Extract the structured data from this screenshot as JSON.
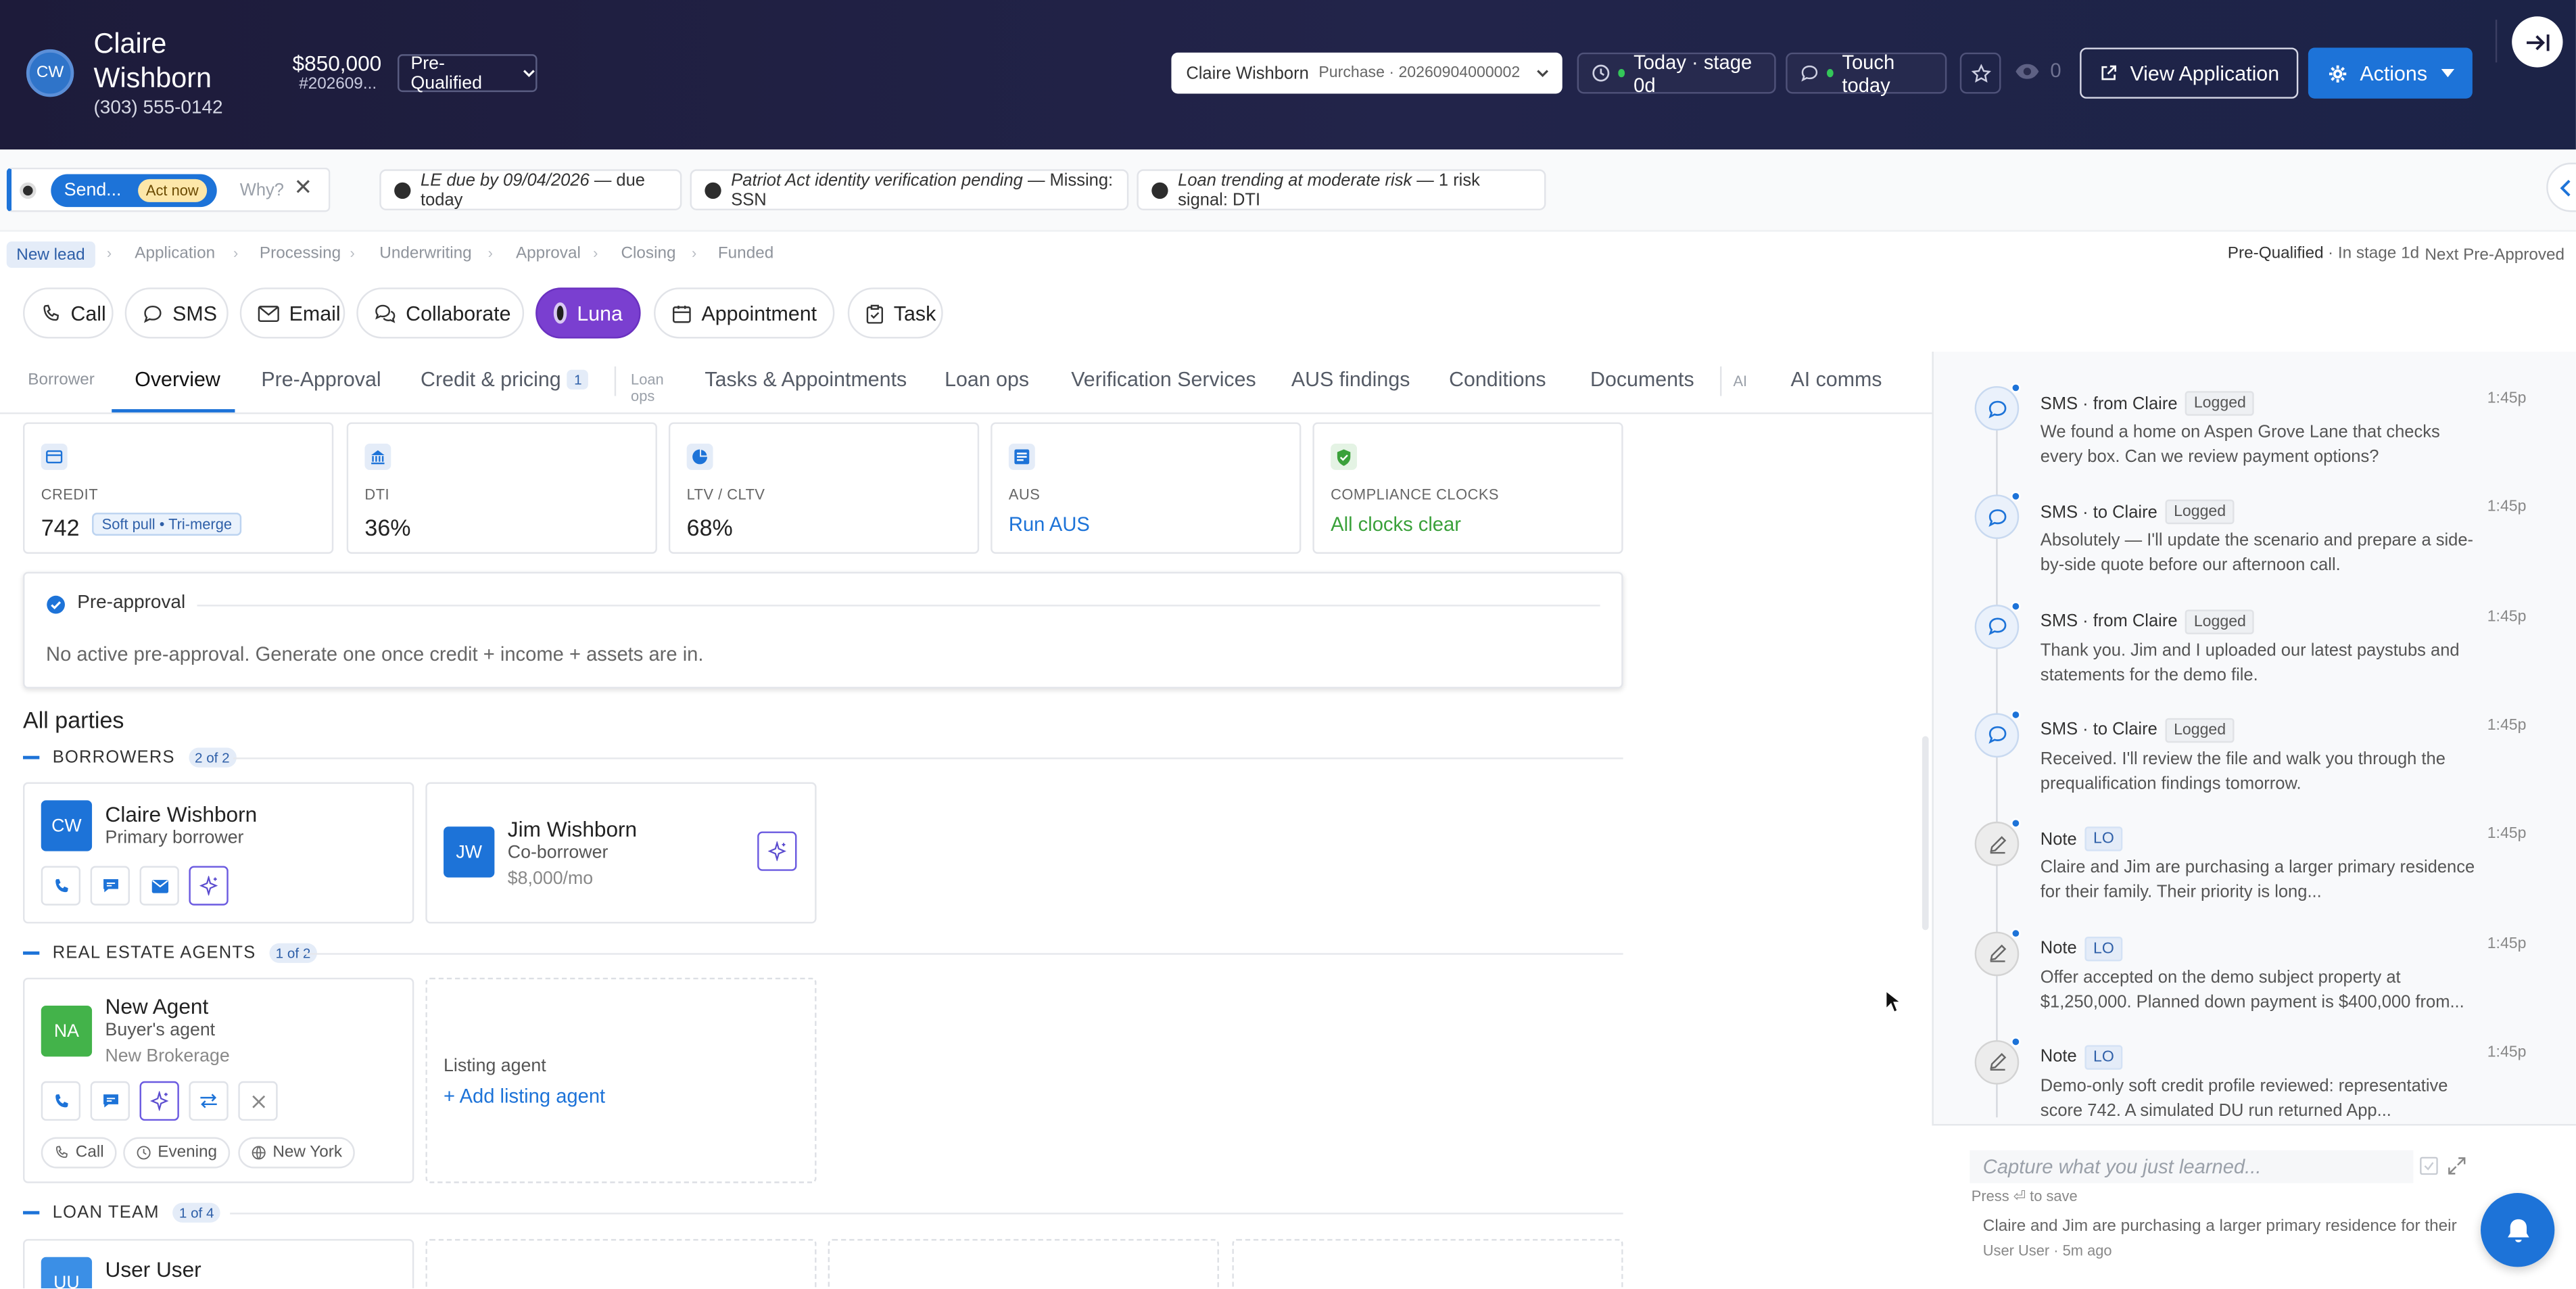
{
  "header": {
    "avatar_initials": "CW",
    "name": "Claire Wishborn",
    "phone": "(303) 555-0142",
    "amount": "$850,000",
    "loan_number": "#202609...",
    "stage": "Pre-Qualified",
    "loan_selector": {
      "name": "Claire Wishborn",
      "detail": "Purchase · 20260904000002"
    },
    "today_stage": "Today · stage 0d",
    "touch": "Touch today",
    "views": "0",
    "view_application": "View Application",
    "actions": "Actions"
  },
  "alerts": {
    "send": "Send...",
    "act_now": "Act now",
    "why": "Why?",
    "chips": [
      {
        "main": "LE due by 09/04/2026",
        "rest": " — due today"
      },
      {
        "main": "Patriot Act identity verification pending",
        "rest": " — Missing: SSN"
      },
      {
        "main": "Loan trending at moderate risk",
        "rest": " — 1 risk signal: DTI"
      }
    ]
  },
  "pipeline": {
    "current": "New lead",
    "stages": [
      "Application",
      "Processing",
      "Underwriting",
      "Approval",
      "Closing",
      "Funded"
    ],
    "status": "Pre-Qualified",
    "in_stage": "· In stage 1d",
    "next": "Next Pre-Approved"
  },
  "action_bar": [
    "Call",
    "SMS",
    "Email",
    "Collaborate",
    "Luna",
    "Appointment",
    "Task"
  ],
  "tabs": {
    "borrower": "Borrower",
    "overview": "Overview",
    "preapproval": "Pre-Approval",
    "credit": "Credit & pricing",
    "credit_badge": "1",
    "loan_ops_small": "Loan ops",
    "tasks": "Tasks & Appointments",
    "loan_ops": "Loan ops",
    "verification": "Verification Services",
    "aus": "AUS findings",
    "conditions": "Conditions",
    "documents": "Documents",
    "ai_small": "AI",
    "ai_comms": "AI comms"
  },
  "kpis": [
    {
      "label": "CREDIT",
      "value": "742",
      "badge": "Soft pull • Tri-merge",
      "icon": "credit-card-icon",
      "color": "#1d73d8"
    },
    {
      "label": "DTI",
      "value": "36%",
      "icon": "bank-icon",
      "color": "#1d73d8"
    },
    {
      "label": "LTV / CLTV",
      "value": "68%",
      "icon": "pie-chart-icon",
      "color": "#1d73d8"
    },
    {
      "label": "AUS",
      "value": "Run AUS",
      "icon": "report-icon",
      "color": "#1d73d8"
    },
    {
      "label": "COMPLIANCE CLOCKS",
      "value": "All clocks clear",
      "icon": "shield-check-icon",
      "color": "#3aa13a"
    }
  ],
  "preapproval": {
    "title": "Pre-approval",
    "message": "No active pre-approval. Generate one once credit + income + assets are in."
  },
  "parties": {
    "title": "All parties",
    "borrowers": {
      "label": "BORROWERS",
      "count": "2 of 2"
    },
    "agents": {
      "label": "REAL ESTATE AGENTS",
      "count": "1 of 2"
    },
    "loan_team": {
      "label": "LOAN TEAM",
      "count": "1 of 4"
    },
    "primary": {
      "initials": "CW",
      "name": "Claire Wishborn",
      "role": "Primary borrower"
    },
    "co": {
      "initials": "JW",
      "name": "Jim Wishborn",
      "role": "Co-borrower",
      "income": "$8,000/mo"
    },
    "agent": {
      "initials": "NA",
      "name": "New Agent",
      "role": "Buyer's agent",
      "brokerage": "New Brokerage",
      "pref_method": "Call",
      "pref_time": "Evening",
      "location": "New York"
    },
    "listing": {
      "label": "Listing agent",
      "add": "+ Add listing agent"
    },
    "team_member": {
      "initials": "UU",
      "name": "User User"
    }
  },
  "timeline": [
    {
      "kind": "sms",
      "title": "SMS · from Claire",
      "tag": "Logged",
      "time": "1:45p",
      "body": "We found a home on Aspen Grove Lane that checks every box. Can we review payment options?"
    },
    {
      "kind": "sms",
      "title": "SMS · to Claire",
      "tag": "Logged",
      "time": "1:45p",
      "body": "Absolutely — I'll update the scenario and prepare a side-by-side quote before our afternoon call."
    },
    {
      "kind": "sms",
      "title": "SMS · from Claire",
      "tag": "Logged",
      "time": "1:45p",
      "body": "Thank you. Jim and I uploaded our latest paystubs and statements for the demo file."
    },
    {
      "kind": "sms",
      "title": "SMS · to Claire",
      "tag": "Logged",
      "time": "1:45p",
      "body": "Received. I'll review the file and walk you through the prequalification findings tomorrow."
    },
    {
      "kind": "note",
      "title": "Note",
      "tag": "LO",
      "time": "1:45p",
      "body": "Claire and Jim are purchasing a larger primary residence for their family. Their priority is long..."
    },
    {
      "kind": "note",
      "title": "Note",
      "tag": "LO",
      "time": "1:45p",
      "body": "Offer accepted on the demo subject property at $1,250,000. Planned down payment is $400,000 from..."
    },
    {
      "kind": "note",
      "title": "Note",
      "tag": "LO",
      "time": "1:45p",
      "body": "Demo-only soft credit profile reviewed: representative score 742. A simulated DU run returned App..."
    }
  ],
  "capture": {
    "placeholder": "Capture what you just learned...",
    "hint": "Press ⏎ to save",
    "last_note": "Claire and Jim are purchasing a larger primary residence for their",
    "last_meta": "User User · 5m ago"
  }
}
